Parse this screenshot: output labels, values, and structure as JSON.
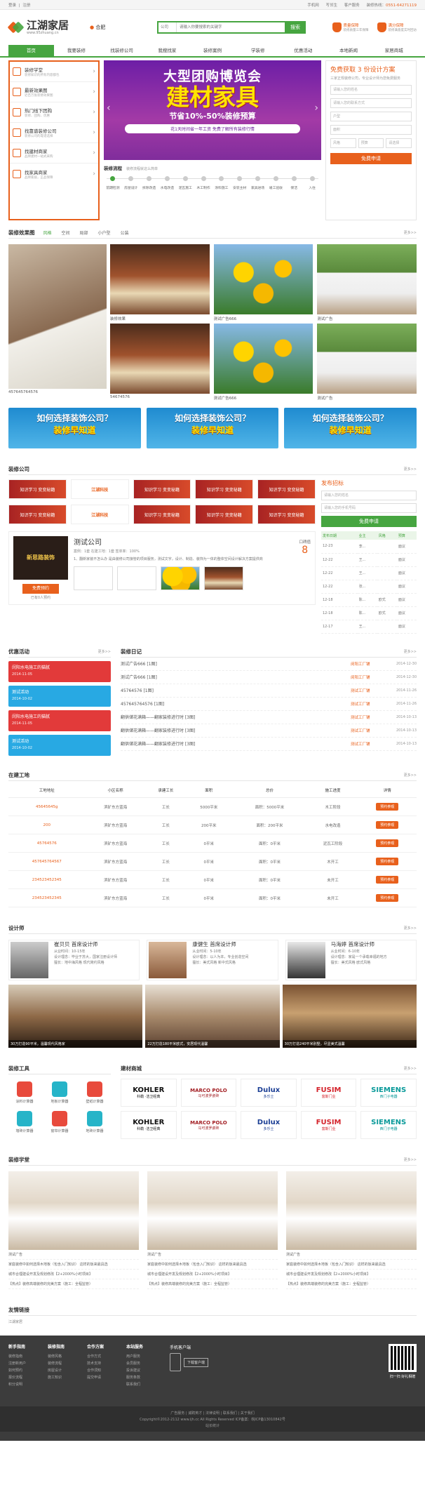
{
  "topbar": {
    "login": "登录",
    "register": "注册",
    "mobile": "手机网",
    "mobile_site": "写邻生",
    "customer": "客户服务",
    "hotline_label": "装修热线：",
    "hotline": "0551-64271119"
  },
  "header": {
    "logo_name": "江湖家居",
    "logo_url": "www.95zhuang.cn",
    "city": "合肥",
    "search_select": "公司",
    "search_placeholder": "请输入你要搜索的关键字",
    "search_btn": "搜索",
    "badge1_title": "质量保障",
    "badge1_sub": "装修质量三年保障",
    "badge2_title": "满分保障",
    "badge2_sub": "装修满意度实时回访"
  },
  "nav": [
    "首页",
    "我要装修",
    "找装修公司",
    "我搜找家",
    "装修案例",
    "学装修",
    "优惠活动",
    "本地新闻",
    "家居商城"
  ],
  "categories": [
    {
      "title": "装修学堂",
      "sub": "装修知识的所有内容都包"
    },
    {
      "title": "最新效果图",
      "sub": "近百万张装修效果图"
    },
    {
      "title": "热门线下团购",
      "sub": "装修、团购、优惠"
    },
    {
      "title": "找靠谱装修公司",
      "sub": "装修公司的靠谱选择"
    },
    {
      "title": "找建材商家",
      "sub": "品牌建材一站式采购"
    },
    {
      "title": "找家具商家",
      "sub": "品牌家居，正品保障"
    }
  ],
  "banner": {
    "line1": "大型团购博览会",
    "line2": "建材家具",
    "line3": "节省10%-50%装修预算",
    "line4": "花1天时间省一年工资  免费了解所有装修行情"
  },
  "flow": {
    "title": "装修流程",
    "subtitle": "装修流程就这么简单",
    "steps": [
      "前期检测",
      "房屋设计",
      "拆除改造",
      "水电改造",
      "泥瓦施工",
      "木工制作",
      "涂料施工",
      "安装主材",
      "家具进场",
      "竣工验收",
      "保洁",
      "入住"
    ]
  },
  "quote": {
    "title": "免费获取 3 份设计方案",
    "sub": "三家正规装修公司，专业设计师为您免费服务",
    "f1": "请输入您的姓名",
    "f2": "请输入您的联系方式",
    "f3": "户型",
    "f4": "面积",
    "f5": "风格",
    "f6": "预算",
    "f7": "请选择",
    "btn": "免费申请"
  },
  "effects": {
    "title": "装修效果图",
    "tabs": [
      "风格",
      "空间",
      "局部",
      "小户型",
      "公装"
    ],
    "more": "更多>>",
    "main_caption": "457645764576",
    "captions": [
      "装修效果",
      "测试广告666",
      "测试广告",
      "54674576",
      "测试广告666",
      "测试广告"
    ],
    "captions2": [
      "54674576",
      "测试广告666",
      "测试广告"
    ]
  },
  "ads": [
    {
      "q": "如何选择装饰公司？",
      "a": "装修早知道"
    },
    {
      "q": "如何选择装饰公司？",
      "a": "装修早知道"
    },
    {
      "q": "如何选择装饰公司？",
      "a": "装修早知道"
    }
  ],
  "company": {
    "title": "装修公司",
    "more": "更多>>",
    "logos": [
      "知识学习 变变秘籍",
      "江湖科技",
      "知识学习 变变秘籍",
      "知识学习 变变秘籍",
      "知识学习 变变秘籍",
      "知识学习 变变秘籍",
      "江湖科技",
      "知识学习 变变秘籍",
      "知识学习 变变秘籍",
      "知识学习 变变秘籍"
    ],
    "card_logo": "新思路装饰",
    "card_name": "测试公司",
    "card_meta": "案例：1套   在建工地：1套   签单率：100%",
    "card_desc": "1、翻新家装不怎么办 是由装修公司接管的项目服务，测试文字，设计、制造、装饰为一体的整体空间设计解决方案提供商",
    "score_label": "口碑值",
    "score": "8",
    "order_btn": "免费预约",
    "ordered": "已有0人预约"
  },
  "bid": {
    "title": "发布招标",
    "f1": "请输入您的姓名",
    "f2": "请输入您的手机号码",
    "btn": "免费申请",
    "cols": [
      "发布日期",
      "业主",
      "风格",
      "预算"
    ],
    "rows": [
      [
        "12-23",
        "李...",
        "",
        "面议"
      ],
      [
        "12-22",
        "王...",
        "",
        "面议"
      ],
      [
        "12-22",
        "王...",
        "",
        "面议"
      ],
      [
        "12-22",
        "张...",
        "",
        "面议"
      ],
      [
        "12-18",
        "陈...",
        "欧式",
        "面议"
      ],
      [
        "12-18",
        "陈...",
        "欧式",
        "面议"
      ],
      [
        "12-17",
        "王...",
        "",
        "面议"
      ]
    ]
  },
  "promo": {
    "title": "优惠活动",
    "more": "更多>>",
    "items": [
      {
        "t": "闵阳水电施工的猫腻",
        "d": "2014-11-05",
        "c": "red"
      },
      {
        "t": "测试活动",
        "d": "2014-10-02",
        "c": "blue"
      },
      {
        "t": "闵阳水电施工的猫腻",
        "d": "2014-11-05",
        "c": "red"
      },
      {
        "t": "测试活动",
        "d": "2014-10-02",
        "c": "blue"
      }
    ]
  },
  "diary": {
    "title": "装修日记",
    "more": "更多>>",
    "rows": [
      [
        "测试广告666 [1图]",
        "闵阳工厂铺",
        "2014-12-30"
      ],
      [
        "测试广告666 [1图]",
        "闵阳工厂铺",
        "2014-12-30"
      ],
      [
        "45764576 [1图]",
        "测试工厂铺",
        "2014-11-26"
      ],
      [
        "457645764576 [1图]",
        "测试工厂铺",
        "2014-11-26"
      ],
      [
        "翻供储花满箱——翻家装修进行时 [3图]",
        "测试工厂铺",
        "2014-10-13"
      ],
      [
        "翻供储花满箱——翻家装修进行时 [3图]",
        "测试工厂铺",
        "2014-10-13"
      ],
      [
        "翻供储花满箱——翻家装修进行时 [3图]",
        "测试工厂铺",
        "2014-10-13"
      ]
    ]
  },
  "sites": {
    "title": "在建工地",
    "more": "更多>>",
    "cols": [
      "工地地址",
      "小区名称",
      "承建工长",
      "面积",
      "总价",
      "施工进度",
      "详情"
    ],
    "rows": [
      [
        "45645645g",
        "滨矿东方蓝海",
        "工长",
        "5000平米",
        "面积：5000平米",
        "木工阶段",
        "预约参观"
      ],
      [
        "200",
        "滨矿东方蓝海",
        "工长",
        "200平米",
        "面积：200平米",
        "水电改造",
        "预约参观"
      ],
      [
        "45764576",
        "滨矿东方蓝海",
        "工长",
        "0平米",
        "面积：0平米",
        "泥瓦工阶段",
        "预约参观"
      ],
      [
        "457645764567",
        "滨矿东方蓝海",
        "工长",
        "0平米",
        "面积：0平米",
        "木开工",
        "预约参观"
      ],
      [
        "234523452345",
        "滨矿东方蓝海",
        "工长",
        "0平米",
        "面积：0平米",
        "未开工",
        "预约参观"
      ],
      [
        "234523452345",
        "滨矿东方蓝海",
        "工长",
        "0平米",
        "面积：0平米",
        "未开工",
        "预约参观"
      ]
    ]
  },
  "designers": {
    "title": "设计师",
    "more": "更多>>",
    "list": [
      {
        "name": "崔贝贝  首席设计师",
        "l1": "从业时间：10-15年",
        "l2": "设计理念：毕业于苏大，国家注册设计师",
        "l3": "擅长：地中海风格 现代简约风格"
      },
      {
        "name": "康健生  首席设计师",
        "l1": "从业时间：5-10年",
        "l2": "设计理念：以人为本，专业创造空间",
        "l3": "擅长：美式风格 新中式风格"
      },
      {
        "name": "马海婷  首席设计师",
        "l1": "从业时间：6-10年",
        "l2": "设计理念：家是一个承载幸福的地方",
        "l3": "擅长：美式风格 欧式风格"
      }
    ],
    "works": [
      "30万打造90平米，温馨现代风格家",
      "22万打造180平米欧式，安居现代温馨",
      "30万打造240平米别墅，尽显美式温馨"
    ]
  },
  "tools": {
    "title": "装修工具",
    "items": [
      "涂料计算器",
      "地板计算器",
      "壁纸计算器",
      "墙砖计算器",
      "窗帘计算器",
      "地砖计算器"
    ]
  },
  "shop": {
    "title": "建材商城",
    "more": "更多>>",
    "brands": [
      {
        "n": "KOHLER",
        "s": "科勒 ·洁卫经典"
      },
      {
        "n": "MARCO POLO",
        "s": "马可波罗瓷砖"
      },
      {
        "n": "Dulux",
        "s": "多乐士"
      },
      {
        "n": "FUSIM",
        "s": "富斯门业"
      },
      {
        "n": "SIEMENS",
        "s": "西门子电器"
      },
      {
        "n": "KOHLER",
        "s": "科勒 ·洁卫经典"
      },
      {
        "n": "MARCO POLO",
        "s": "马可波罗瓷砖"
      },
      {
        "n": "Dulux",
        "s": "多乐士"
      },
      {
        "n": "FUSIM",
        "s": "富斯门业"
      },
      {
        "n": "SIEMENS",
        "s": "西门子电器"
      }
    ]
  },
  "learn": {
    "title": "装修学堂",
    "more": "更多>>",
    "cols": [
      {
        "cap": "测试广告",
        "l1": "家庭装修中如何选择木地板（包含入门知识）  这样的饭来最具选",
        "l2": "城市合理建设开发及规划修改【2+2000%小时项目】",
        "l3": "【热点】装修高端装修的完美方案（施工：全程监管）"
      },
      {
        "cap": "测试广告",
        "l1": "家庭装修中如何选择木地板（包含入门知识）  这样的饭来最具选",
        "l2": "城市合理建设开发及规划修改【2+2000%小时项目】",
        "l3": "【热点】装修高端装修的完美方案（施工：全程监管）"
      },
      {
        "cap": "测试广告",
        "l1": "家庭装修中如何选择木地板（包含入门知识）  这样的饭来最具选",
        "l2": "城市合理建设开发及规划修改【2+2000%小时项目】",
        "l3": "【热点】装修高端装修的完美方案（施工：全程监管）"
      }
    ]
  },
  "friend": {
    "title": "友情链接",
    "link": "江湖家居"
  },
  "footer": {
    "cols": [
      {
        "t": "新手指南",
        "items": [
          "装修指南",
          "注册新用户",
          "如何预约",
          "报价流程",
          "积分说明"
        ]
      },
      {
        "t": "装修指南",
        "items": [
          "装修风格",
          "装修流程",
          "房屋设计",
          "施工知识"
        ]
      },
      {
        "t": "合作方案",
        "items": [
          "合作方式",
          "技术支持",
          "合作须知",
          "提交申请"
        ]
      },
      {
        "t": "本站服务",
        "items": [
          "用户服务",
          "会员服务",
          "投诉建议",
          "服务条款",
          "联系我们"
        ]
      }
    ],
    "app_title": "手机客户端",
    "app_dl": "下载客户端",
    "qr_cap": "扫一扫 好礼相赠",
    "links": "广告服务  |  诚聘英才  |  法律说明  |  联系我们  |  关于我们",
    "copyright": "Copyright©2012-2112 www.ijh.cc All Rights Reserved ICP备案：皖ICP备13010842号",
    "stats": "站长统计"
  }
}
